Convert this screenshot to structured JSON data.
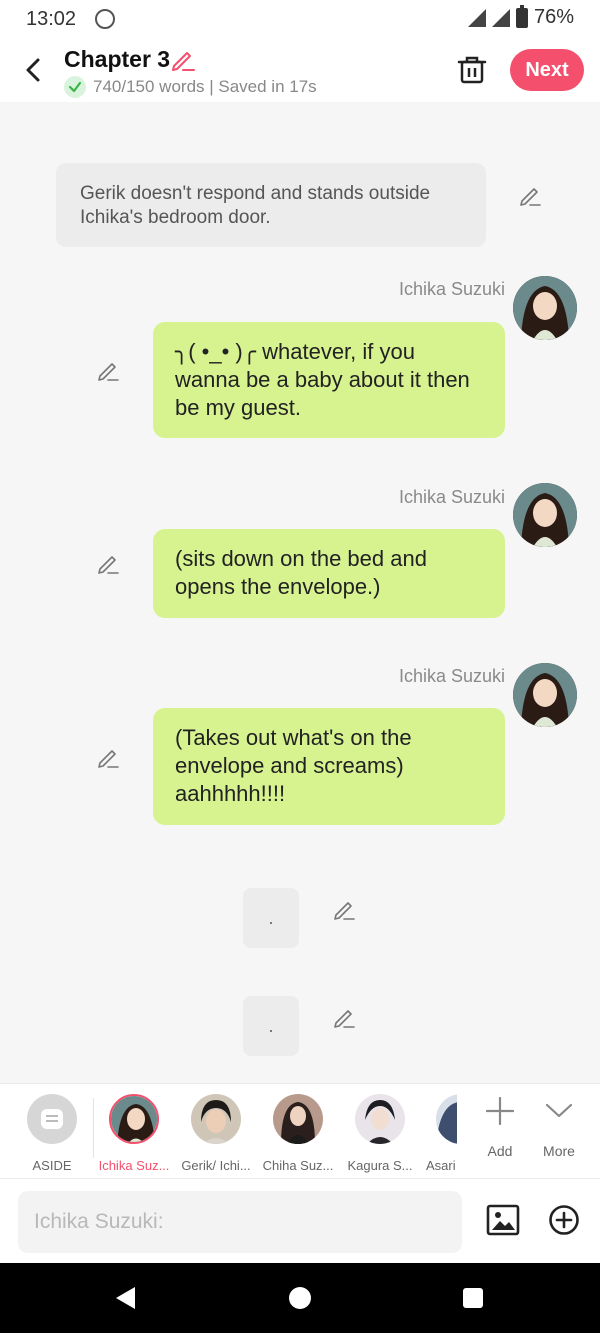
{
  "status": {
    "time": "13:02",
    "battery": "76%"
  },
  "header": {
    "title": "Chapter 3",
    "saved_text": "740/150 words | Saved in 17s",
    "next_label": "Next"
  },
  "chat": {
    "aside_text": "Gerik doesn't respond and stands outside Ichika's bedroom door.",
    "messages": [
      {
        "speaker": "Ichika Suzuki",
        "text": "╮( •_• )╭ whatever, if you wanna be a baby about it then be my guest."
      },
      {
        "speaker": "Ichika Suzuki",
        "text": "(sits down on the bed and opens the envelope.)"
      },
      {
        "speaker": "Ichika Suzuki",
        "text": "(Takes out what's on the envelope and screams) aahhhhh!!!!"
      }
    ],
    "dot_bubbles": [
      ".",
      "."
    ]
  },
  "characters": {
    "aside_label": "ASIDE",
    "items": [
      {
        "name": "Ichika Suz...",
        "active": true
      },
      {
        "name": "Gerik/ Ichi...",
        "active": false
      },
      {
        "name": "Chiha Suz...",
        "active": false
      },
      {
        "name": "Kagura S...",
        "active": false
      },
      {
        "name": "Asari",
        "active": false
      }
    ],
    "add_label": "Add",
    "more_label": "More"
  },
  "input": {
    "placeholder": "Ichika Suzuki:"
  },
  "colors": {
    "accent": "#f44f6d",
    "bubble_green": "#d7f390",
    "aside_gray": "#ececec"
  },
  "icons": {
    "back": "chevron-left-icon",
    "edit": "pencil-icon",
    "trash": "trash-icon",
    "image": "image-icon",
    "add": "plus-circle-icon"
  }
}
